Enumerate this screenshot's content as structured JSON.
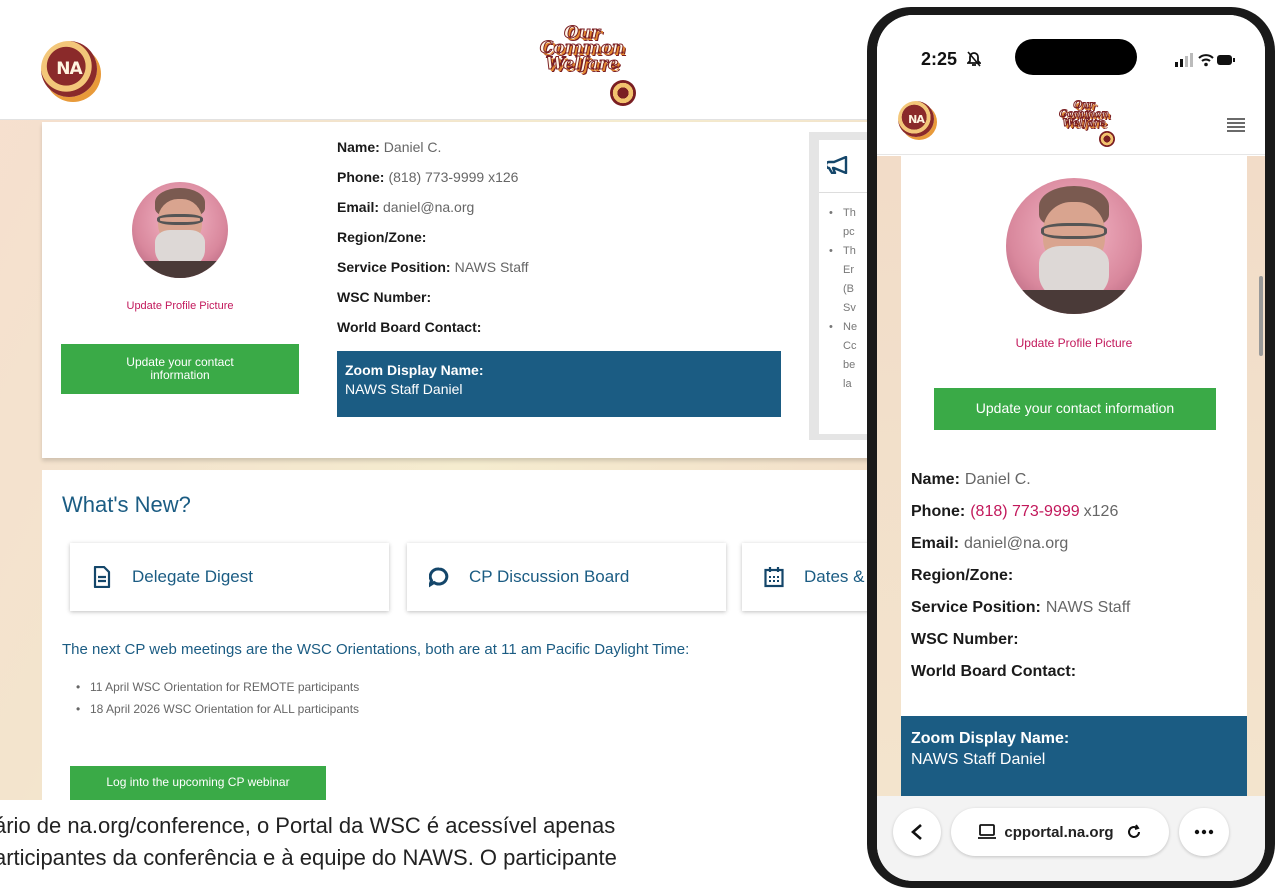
{
  "desktop": {
    "profile": {
      "update_picture_label": "Update Profile Picture",
      "update_contact_label": "Update your contact information",
      "fields": [
        {
          "label": "Name:",
          "value": "Daniel C."
        },
        {
          "label": "Phone:",
          "value": "(818) 773-9999 x126"
        },
        {
          "label": "Email:",
          "value": "daniel@na.org"
        },
        {
          "label": "Region/Zone:",
          "value": ""
        },
        {
          "label": "Service Position:",
          "value": "NAWS Staff"
        },
        {
          "label": "WSC Number:",
          "value": ""
        },
        {
          "label": "World Board Contact:",
          "value": ""
        }
      ],
      "zoom_label": "Zoom Display Name:",
      "zoom_value": "NAWS Staff Daniel"
    },
    "announcements": {
      "bullets": [
        [
          "Th",
          "pc"
        ],
        [
          "Th",
          "Er",
          "(B",
          "Sv"
        ],
        [
          "Ne",
          "Cc",
          "be",
          "la"
        ]
      ]
    },
    "news": {
      "title": "What's New?",
      "cards": [
        {
          "label": "Delegate Digest",
          "icon": "document-icon"
        },
        {
          "label": "CP Discussion Board",
          "icon": "chat-bubble-icon"
        },
        {
          "label": "Dates &",
          "icon": "calendar-icon"
        }
      ],
      "next_meetings": "The next CP web meetings are the WSC Orientations, both are at 11 am Pacific Daylight Time:",
      "meetings": [
        "11 April WSC Orientation for REMOTE participants",
        "18 April 2026 WSC Orientation for ALL participants"
      ],
      "webinar_button": "Log into the upcoming CP webinar"
    }
  },
  "caption": {
    "line1": "ário de na.org/conference, o Portal da WSC é acessível apenas",
    "line2": "articipantes da conferência e à equipe do NAWS. O participante"
  },
  "phone": {
    "time": "2:25",
    "update_picture_label": "Update Profile Picture",
    "update_contact_label": "Update your contact information",
    "fields": [
      {
        "label": "Name:",
        "value": "Daniel C."
      },
      {
        "label": "Phone:",
        "value": "(818) 773-9999",
        "extra": "x126"
      },
      {
        "label": "Email:",
        "value": "daniel@na.org"
      },
      {
        "label": "Region/Zone:",
        "value": ""
      },
      {
        "label": "Service Position:",
        "value": "NAWS Staff"
      },
      {
        "label": "WSC Number:",
        "value": ""
      },
      {
        "label": "World Board Contact:",
        "value": ""
      }
    ],
    "zoom_label": "Zoom Display Name:",
    "zoom_value": "NAWS Staff Daniel",
    "url": "cpportal.na.org"
  },
  "logos": {
    "na_text": "NA",
    "ocw_words": [
      "Our",
      "Common",
      "Welfare"
    ]
  },
  "colors": {
    "accent_blue": "#1b5c83",
    "button_green": "#3aaa47",
    "link_pink": "#c2185b"
  }
}
